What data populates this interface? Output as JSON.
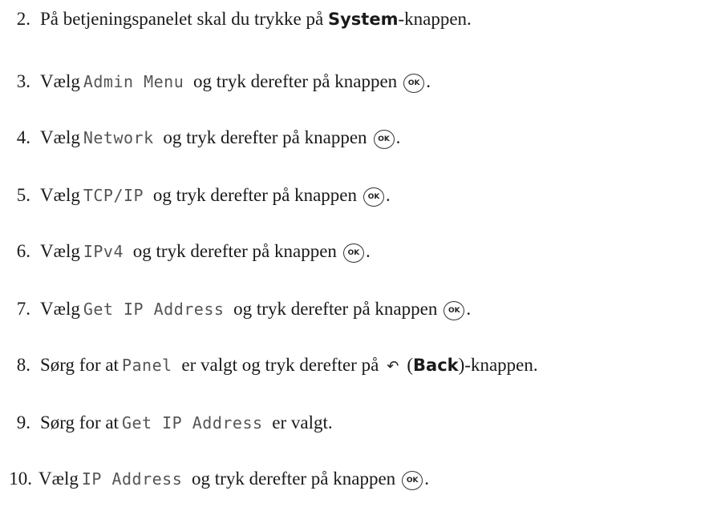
{
  "steps": [
    {
      "number": "2.",
      "parts": [
        {
          "type": "text",
          "value": "På betjeningspanelet skal du trykke på "
        },
        {
          "type": "strong",
          "value": "System"
        },
        {
          "type": "text",
          "value": "-knappen."
        }
      ]
    },
    {
      "number": "3.",
      "parts": [
        {
          "type": "text",
          "value": "Vælg"
        },
        {
          "type": "lcd",
          "value": "Admin Menu"
        },
        {
          "type": "text",
          "value": "og tryk derefter på knappen"
        },
        {
          "type": "ok",
          "value": "OK"
        },
        {
          "type": "text",
          "value": "."
        }
      ]
    },
    {
      "number": "4.",
      "parts": [
        {
          "type": "text",
          "value": "Vælg"
        },
        {
          "type": "lcd",
          "value": "Network"
        },
        {
          "type": "text",
          "value": "og tryk derefter på knappen"
        },
        {
          "type": "ok",
          "value": "OK"
        },
        {
          "type": "text",
          "value": "."
        }
      ]
    },
    {
      "number": "5.",
      "parts": [
        {
          "type": "text",
          "value": "Vælg"
        },
        {
          "type": "lcd",
          "value": "TCP/IP"
        },
        {
          "type": "text",
          "value": "og tryk derefter på knappen"
        },
        {
          "type": "ok",
          "value": "OK"
        },
        {
          "type": "text",
          "value": "."
        }
      ]
    },
    {
      "number": "6.",
      "parts": [
        {
          "type": "text",
          "value": "Vælg"
        },
        {
          "type": "lcd",
          "value": "IPv4"
        },
        {
          "type": "text",
          "value": "og tryk derefter på knappen"
        },
        {
          "type": "ok",
          "value": "OK"
        },
        {
          "type": "text",
          "value": "."
        }
      ]
    },
    {
      "number": "7.",
      "parts": [
        {
          "type": "text",
          "value": "Vælg"
        },
        {
          "type": "lcd",
          "value": "Get IP Address"
        },
        {
          "type": "text",
          "value": "og tryk derefter på knappen"
        },
        {
          "type": "ok",
          "value": "OK"
        },
        {
          "type": "text",
          "value": "."
        }
      ]
    },
    {
      "number": "8.",
      "parts": [
        {
          "type": "text",
          "value": "Sørg for at"
        },
        {
          "type": "lcd",
          "value": "Panel"
        },
        {
          "type": "text",
          "value": "er valgt og tryk derefter på"
        },
        {
          "type": "back",
          "value": "back-arrow-icon"
        },
        {
          "type": "text",
          "value": "("
        },
        {
          "type": "strong",
          "value": "Back"
        },
        {
          "type": "text",
          "value": ")-knappen."
        }
      ]
    },
    {
      "number": "9.",
      "parts": [
        {
          "type": "text",
          "value": "Sørg for at"
        },
        {
          "type": "lcd",
          "value": "Get IP Address"
        },
        {
          "type": "text",
          "value": "er valgt."
        }
      ]
    },
    {
      "number": "10.",
      "parts": [
        {
          "type": "text",
          "value": "Vælg"
        },
        {
          "type": "lcd",
          "value": "IP Address"
        },
        {
          "type": "text",
          "value": "og tryk derefter på knappen"
        },
        {
          "type": "ok",
          "value": "OK"
        },
        {
          "type": "text",
          "value": "."
        }
      ]
    }
  ]
}
